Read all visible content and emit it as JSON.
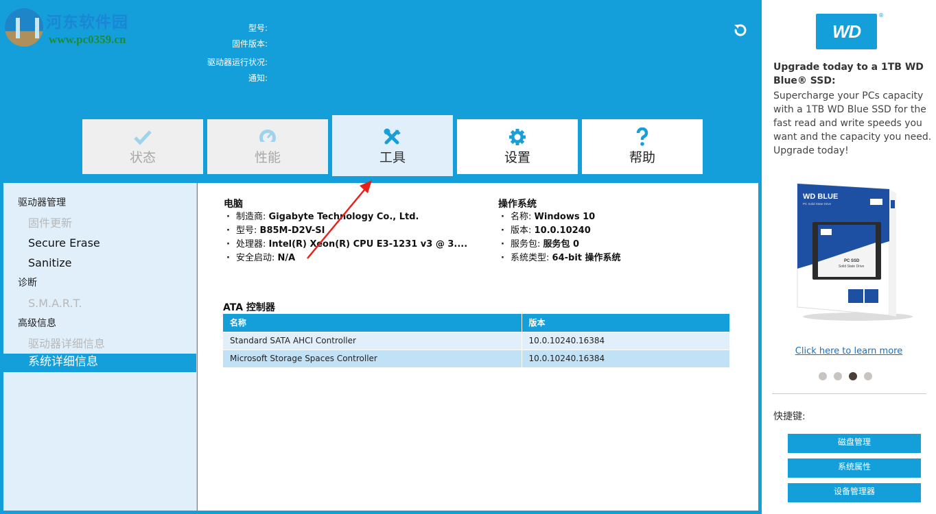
{
  "watermark": {
    "title": "河东软件园",
    "url": "www.pc0359.cn"
  },
  "drive_info": {
    "labels": [
      "型号:",
      "固件版本:",
      "驱动器运行状况:",
      "通知:"
    ]
  },
  "icons": {
    "refresh": "refresh-icon"
  },
  "tabs": [
    {
      "label": "状态",
      "icon": "checkmark-icon",
      "state": "disabled"
    },
    {
      "label": "性能",
      "icon": "speedometer-icon",
      "state": "disabled"
    },
    {
      "label": "工具",
      "icon": "tools-icon",
      "state": "active"
    },
    {
      "label": "设置",
      "icon": "gear-icon",
      "state": "normal"
    },
    {
      "label": "帮助",
      "icon": "help-icon",
      "state": "normal"
    }
  ],
  "sidebar": {
    "groups": [
      {
        "label": "驱动器管理",
        "items": [
          {
            "label": "固件更新",
            "state": "disabled"
          },
          {
            "label": "Secure Erase",
            "state": "normal"
          },
          {
            "label": "Sanitize",
            "state": "normal"
          }
        ]
      },
      {
        "label": "诊断",
        "items": [
          {
            "label": "S.M.A.R.T.",
            "state": "disabled"
          }
        ]
      },
      {
        "label": "高级信息",
        "items": [
          {
            "label": "驱动器详细信息",
            "state": "disabled"
          },
          {
            "label": "系统详细信息",
            "state": "selected"
          }
        ]
      }
    ]
  },
  "computer": {
    "title": "电脑",
    "fields": [
      {
        "key": "制造商:",
        "value": "Gigabyte Technology Co., Ltd."
      },
      {
        "key": "型号:",
        "value": "B85M-D2V-SI"
      },
      {
        "key": "处理器:",
        "value": "Intel(R) Xeon(R) CPU E3-1231 v3 @ 3...."
      },
      {
        "key": "安全启动:",
        "value": "N/A"
      }
    ]
  },
  "os": {
    "title": "操作系统",
    "fields": [
      {
        "key": "名称:",
        "value": "Windows 10"
      },
      {
        "key": "版本:",
        "value": "10.0.10240"
      },
      {
        "key": "服务包:",
        "value": "服务包 0"
      },
      {
        "key": "系统类型:",
        "value": "64-bit 操作系统"
      }
    ]
  },
  "ata": {
    "title": "ATA 控制器",
    "columns": [
      "名称",
      "版本"
    ],
    "rows": [
      [
        "Standard SATA AHCI Controller",
        "10.0.10240.16384"
      ],
      [
        "Microsoft Storage Spaces Controller",
        "10.0.10240.16384"
      ]
    ]
  },
  "promo": {
    "logo_text": "WD",
    "logo_reg": "®",
    "title": "Upgrade today to a 1TB WD Blue® SSD:",
    "body": "Supercharge your PCs capacity with a 1TB WD Blue SSD for the fast read and write speeds you want and the capacity you need. Upgrade today!",
    "product_box_brand": "WD BLUE",
    "product_box_sub": "PC Solid State Drive",
    "product_drive_text": "PC SSD",
    "product_drive_sub": "Solid State Drive",
    "link": "Click here to learn more",
    "carousel_total": 4,
    "carousel_active": 3
  },
  "shortcuts": {
    "label": "快捷键:",
    "buttons": [
      "磁盘管理",
      "系统属性",
      "设备管理器"
    ]
  },
  "colors": {
    "accent": "#159fda",
    "panel_bg": "#e1effa",
    "row_alt": "#c0e1f6",
    "annotation": "#e8201a"
  }
}
